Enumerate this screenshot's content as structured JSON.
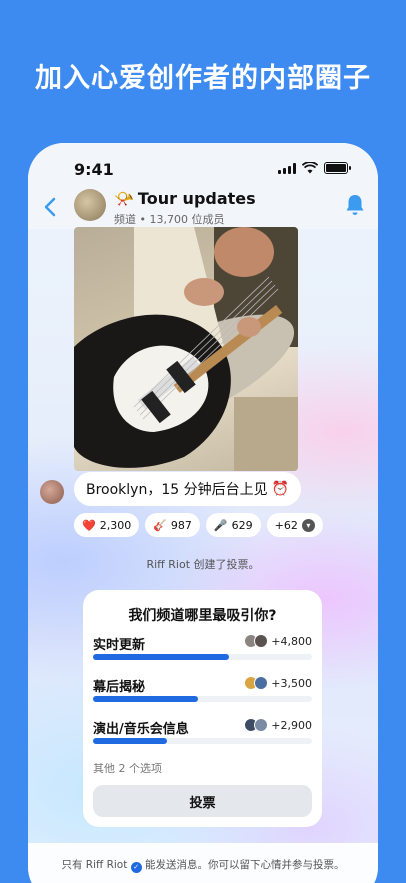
{
  "headline": "加入心爱创作者的内部圈子",
  "status": {
    "time": "9:41"
  },
  "channel": {
    "emoji": "📯",
    "name": "Tour updates",
    "subtitle": "频道 • 13,700 位成员"
  },
  "message": {
    "text": "Brooklyn，15 分钟后台上见",
    "emoji": "⏰"
  },
  "reactions": [
    {
      "emoji": "❤️",
      "count": "2,300"
    },
    {
      "emoji": "🎸",
      "count": "987"
    },
    {
      "emoji": "🎤",
      "count": "629"
    },
    {
      "emoji": "",
      "count": "+62"
    }
  ],
  "system_message": "Riff Riot 创建了投票。",
  "poll": {
    "question": "我们频道哪里最吸引你?",
    "options": [
      {
        "label": "实时更新",
        "count": "+4,800",
        "fraction": 0.62
      },
      {
        "label": "幕后揭秘",
        "count": "+3,500",
        "fraction": 0.48
      },
      {
        "label": "演出/音乐会信息",
        "count": "+2,900",
        "fraction": 0.34
      }
    ],
    "other": "其他 2 个选项",
    "vote_label": "投票"
  },
  "footer": {
    "prefix": "只有 Riff Riot",
    "suffix": "能发送消息。你可以留下心情并参与投票。"
  },
  "colors": {
    "accent": "#1f6ae0",
    "brand_bg": "#3d8af0",
    "icon_blue": "#3a9bf0"
  }
}
